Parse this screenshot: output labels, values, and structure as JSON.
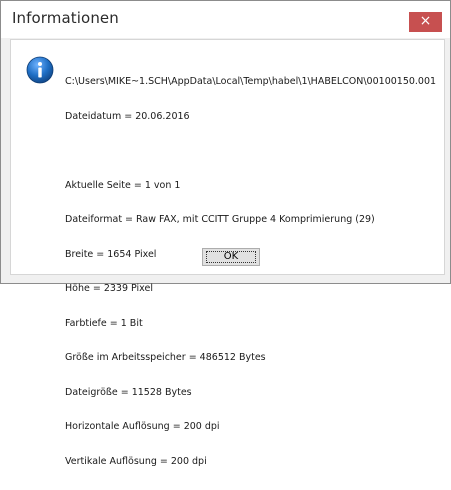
{
  "dialog": {
    "title": "Informationen",
    "close_label": "×",
    "icon": "info-icon",
    "ok_label": "OK",
    "accent_close": "#c75050",
    "accent_icon": "#1f6fc5"
  },
  "info": {
    "path": "C:\\Users\\MIKE~1.SCH\\AppData\\Local\\Temp\\habel\\1\\HABELCON\\00100150.001",
    "date": "Dateidatum = 20.06.2016",
    "page": "Aktuelle Seite = 1 von 1",
    "format": "Dateiformat = Raw FAX, mit CCITT Gruppe 4 Komprimierung (29)",
    "width": "Breite = 1654 Pixel",
    "height": "Höhe = 2339 Pixel",
    "depth": "Farbtiefe = 1 Bit",
    "memory": "Größe im Arbeitsspeicher = 486512 Bytes",
    "filesize": "Dateigröße = 11528 Bytes",
    "hres": "Horizontale Auflösung = 200 dpi",
    "vres": "Vertikale Auflösung = 200 dpi"
  }
}
